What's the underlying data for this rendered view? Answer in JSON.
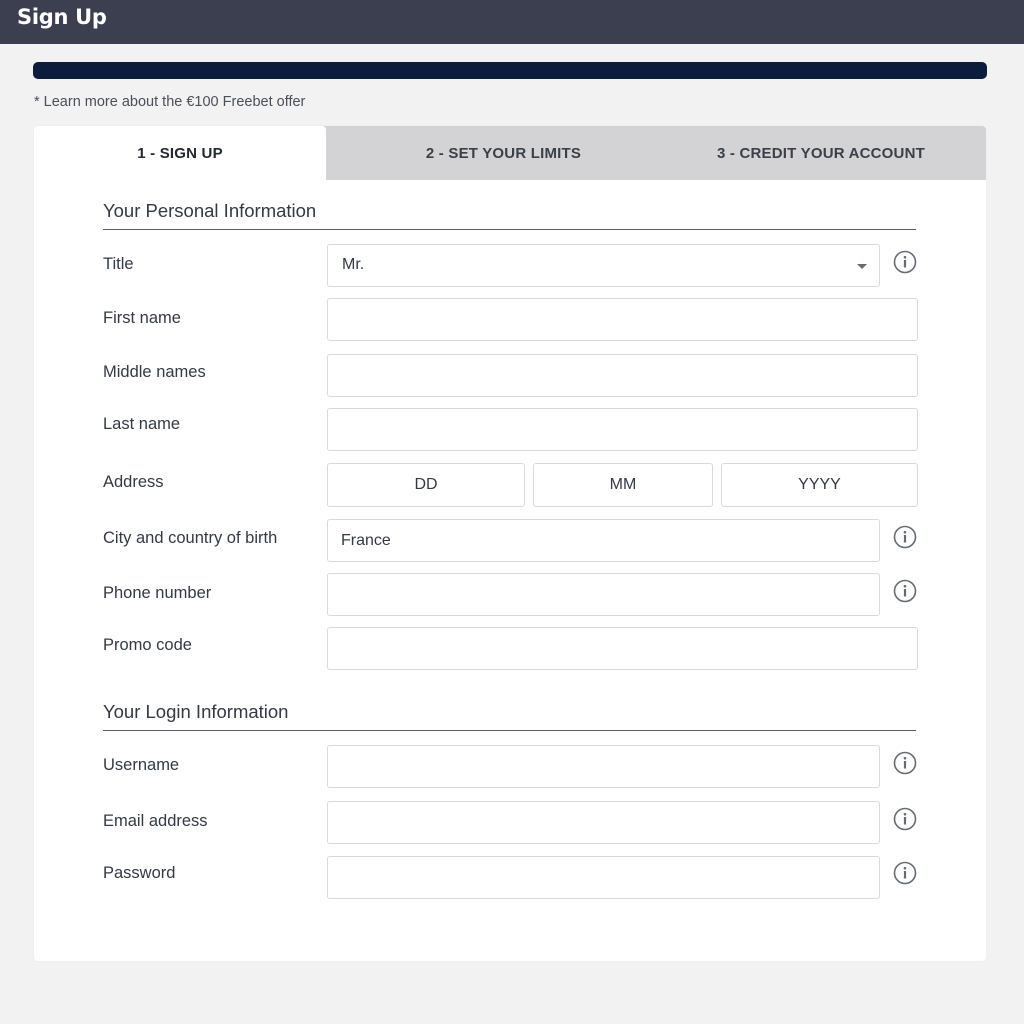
{
  "header": {
    "title": "Sign Up"
  },
  "offer_link": "* Learn more about the €100 Freebet offer",
  "tabs": [
    {
      "label": "1 - SIGN UP",
      "active": true
    },
    {
      "label": "2 - SET YOUR LIMITS",
      "active": false
    },
    {
      "label": "3 - CREDIT YOUR ACCOUNT",
      "active": false
    }
  ],
  "personal": {
    "title": "Your Personal Information",
    "title_field": {
      "label": "Title",
      "value": "Mr."
    },
    "first_name": {
      "label": "First name",
      "value": ""
    },
    "middle_names": {
      "label": "Middle names",
      "value": ""
    },
    "last_name": {
      "label": "Last name",
      "value": ""
    },
    "address": {
      "label": "Address",
      "dd": "DD",
      "mm": "MM",
      "yyyy": "YYYY"
    },
    "birthplace": {
      "label": "City and country of birth",
      "value": "France"
    },
    "phone": {
      "label": "Phone number",
      "value": ""
    },
    "promo": {
      "label": "Promo code",
      "value": ""
    }
  },
  "login": {
    "title": "Your Login Information",
    "username": {
      "label": "Username",
      "value": ""
    },
    "email": {
      "label": "Email address",
      "value": ""
    },
    "password": {
      "label": "Password",
      "value": ""
    }
  },
  "icons": {
    "info": "info-circle-icon",
    "caret": "chevron-down-icon"
  },
  "colors": {
    "topbar": "#3b3f4f",
    "banner": "#0b1c3d",
    "tab_inactive": "#d3d3d5"
  }
}
